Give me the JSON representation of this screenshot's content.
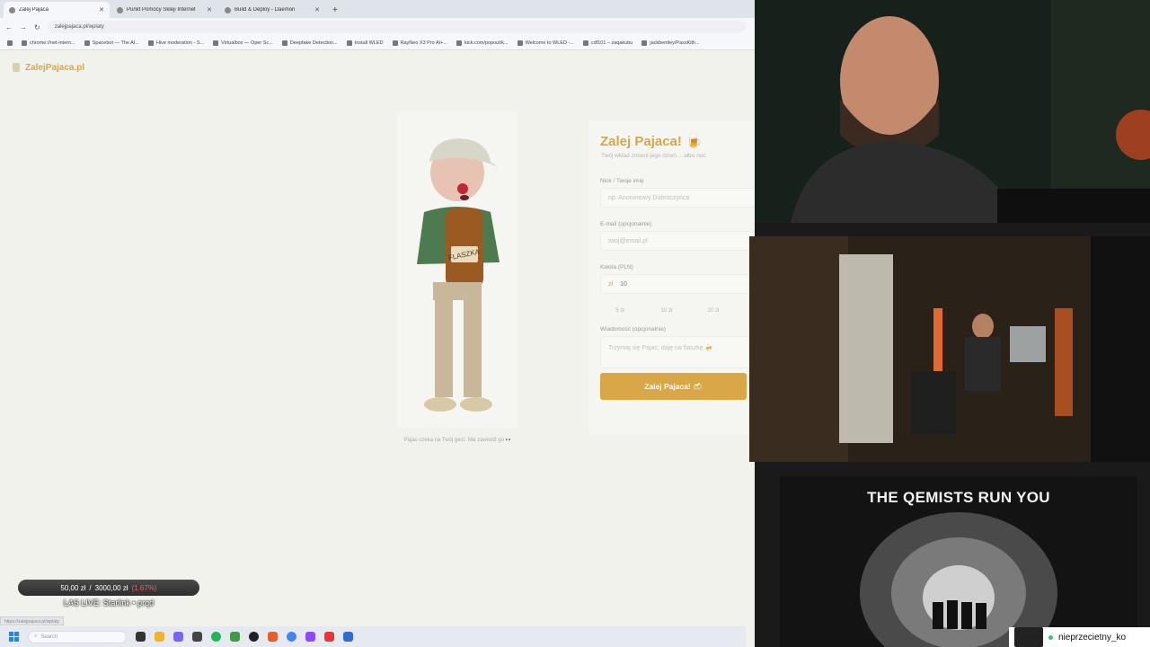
{
  "browser": {
    "tabs": [
      {
        "label": "Zalej Pajaca",
        "active": true
      },
      {
        "label": "Punkt Pomocy Skleji Internet",
        "active": false
      },
      {
        "label": "Build & Deploy - Daemon",
        "active": false
      }
    ],
    "new_tab_glyph": "+",
    "url": "zalejpajaca.pl/wplaty",
    "bookmarks": [
      "chrome://net-intern...",
      "Spacebot — The AI...",
      "Hive moderation - S...",
      "Virtualbox — Oper Sc...",
      "Deepfake Detection...",
      "Install WLED",
      "RayNeo X3 Pro AI+...",
      "kick.com/popout/k...",
      "Welcome to WLED -...",
      "cdf101 – zaqakubu",
      "jackbentley/PassKith..."
    ],
    "status_url": "https://zalejpajaca.pl/wplaty"
  },
  "site": {
    "name": "ZalejPajaca.pl",
    "mascot_caption": "Pajac czeka na Twój gest. Nie zawiedź go 👀",
    "form": {
      "title": "Zalej Pajaca! 🍺",
      "subtitle": "Twój wkład zmieni jego dzień… albo noc",
      "nick_label": "Nick / Twoje imię",
      "nick_placeholder": "np. Anonimowy Dobroczyńca",
      "email_label": "E-mail (opcjonalnie)",
      "email_placeholder": "twoj@email.pl",
      "amount_label": "Kwota (PLN)",
      "amount_currency": "zł",
      "amount_value": "10",
      "amount_chips": [
        "5 zł",
        "10 zł",
        "20 zł"
      ],
      "message_label": "Wiadomość (opcjonalnie)",
      "message_placeholder": "Trzymaj się Pajac, daję na flaszkę 🍻",
      "submit_label": "Zalej Pajaca! 🍻"
    }
  },
  "overlay": {
    "donation_current": "50,00 zł",
    "donation_separator": "/",
    "donation_goal": "3000,00 zł",
    "donation_percent": "(1.67%)",
    "donation_progress": 0.0167,
    "live_label": "LAS LIVE: Starlink • prqd"
  },
  "taskbar": {
    "search_placeholder": "Search"
  },
  "media": {
    "title": "THE QEMISTS RUN YOU"
  },
  "chat": {
    "username": "nieprzecietny_ko"
  },
  "colors": {
    "accent": "#d7a64a",
    "button": "#d9a745",
    "percent": "#ff5a5a",
    "online": "#2ecc71"
  }
}
